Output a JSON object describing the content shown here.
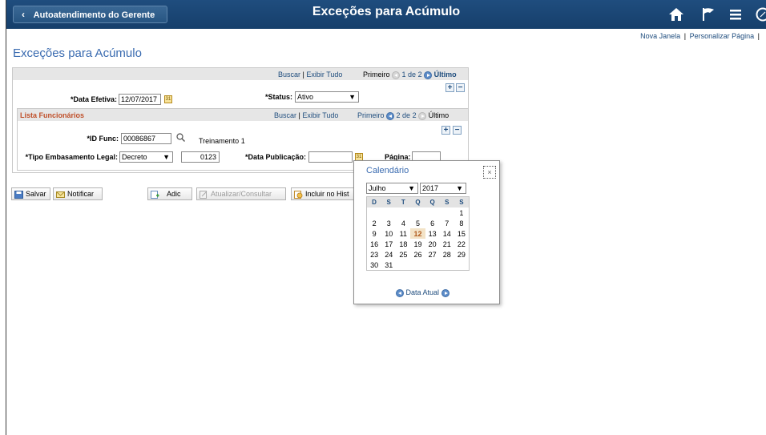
{
  "header": {
    "back_label": "Autoatendimento do Gerente",
    "title": "Exceções para Acúmulo"
  },
  "links": {
    "new_window": "Nova Janela",
    "personalize": "Personalizar Página",
    "sep": "|"
  },
  "page_title": "Exceções para Acúmulo",
  "effective_section": {
    "find": "Buscar",
    "view_all": "Exibir Tudo",
    "sep": "|",
    "first": "Primeiro",
    "counter": "1 de 2",
    "last": "Último",
    "date_label": "*Data Efetiva:",
    "date_value": "12/07/2017",
    "status_label": "*Status:",
    "status_value": "Ativo"
  },
  "employee_section": {
    "title": "Lista Funcionários",
    "find": "Buscar",
    "view_all": "Exibir Tudo",
    "sep": "|",
    "first": "Primeiro",
    "counter": "2 de 2",
    "last": "Último",
    "id_label": "*ID Func:",
    "id_value": "00086867",
    "id_name": "Treinamento 1",
    "legal_label": "*Tipo Embasamento Legal:",
    "legal_value": "Decreto",
    "legal_number": "0123",
    "pub_date_label": "*Data Publicação:",
    "pub_date_value": "",
    "page_label": "Página:",
    "page_value": ""
  },
  "toolbar": {
    "save": "Salvar",
    "notify": "Notificar",
    "add": "Adic",
    "update": "Atualizar/Consultar",
    "history": "Incluir no Hist"
  },
  "calendar": {
    "title": "Calendário",
    "close": "×",
    "month": "Julho",
    "year": "2017",
    "weekdays": [
      "D",
      "S",
      "T",
      "Q",
      "Q",
      "S",
      "S"
    ],
    "weeks": [
      [
        "",
        "",
        "",
        "",
        "",
        "",
        "1"
      ],
      [
        "2",
        "3",
        "4",
        "5",
        "6",
        "7",
        "8"
      ],
      [
        "9",
        "10",
        "11",
        "12",
        "13",
        "14",
        "15"
      ],
      [
        "16",
        "17",
        "18",
        "19",
        "20",
        "21",
        "22"
      ],
      [
        "23",
        "24",
        "25",
        "26",
        "27",
        "28",
        "29"
      ],
      [
        "30",
        "31",
        "",
        "",
        "",
        "",
        ""
      ]
    ],
    "today": "12",
    "today_link": "Data Atual"
  },
  "colors": {
    "header_bg": "#1f4d7e",
    "link": "#1f4d7e",
    "title": "#3a6bb0",
    "section_title": "#c0502a"
  },
  "icons": [
    "back-chevron-icon",
    "home-icon",
    "flag-icon",
    "menu-icon",
    "navbar-icon",
    "search-icon",
    "calendar-icon",
    "add-row-icon",
    "delete-row-icon",
    "prev-icon",
    "next-icon"
  ]
}
